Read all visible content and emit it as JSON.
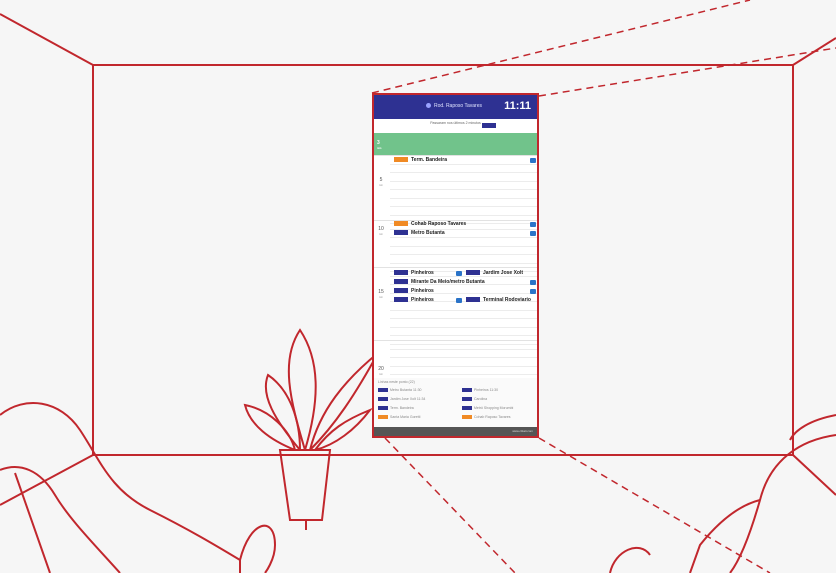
{
  "scene": {
    "line_color": "#c1272d",
    "background": "#f6f6f6"
  },
  "display": {
    "stop_name": "Rod. Raposo Tavares",
    "clock": "11:11",
    "update_note": "Passaram nos últimos 2 minutos",
    "header_color": "#2e3192",
    "green_minutes": "3",
    "sections": [
      {
        "minutes": "5",
        "unit": "min",
        "rows": [
          {
            "route_color": "orange",
            "dest": "Term. Bandeira"
          }
        ]
      },
      {
        "minutes": "10",
        "unit": "min",
        "rows": [
          {
            "route_color": "orange",
            "dest": "Cohab Raposo Tavares"
          },
          {
            "route_color": "blue",
            "dest": "Metro Butanta"
          }
        ]
      },
      {
        "minutes": "15",
        "unit": "min",
        "rows": [
          {
            "route_color": "blue",
            "dest": "Pinheiros",
            "dest2": "Jardim Jose Xolt"
          },
          {
            "route_color": "blue",
            "dest": "Mirante Da Meio/metro Butanta"
          },
          {
            "route_color": "blue",
            "dest": "Pinheiros"
          },
          {
            "route_color": "blue",
            "dest": "Pinheiros",
            "dest2": "Terminal Rodoviario"
          }
        ]
      },
      {
        "minutes": "20",
        "unit": "min",
        "rows": []
      }
    ],
    "footer_title": "Linhas neste ponto (22)",
    "footer_items": [
      {
        "dest": "Metro Butanta",
        "time": "11:30",
        "color": "blue"
      },
      {
        "dest": "Pinheiros",
        "time": "11:30",
        "color": "blue"
      },
      {
        "dest": "Jardim Jose Xolt",
        "time": "11:34",
        "color": "blue"
      },
      {
        "dest": "Carolina",
        "time": "",
        "color": "blue"
      },
      {
        "dest": "Term. Bandeira",
        "time": "",
        "color": "blue"
      },
      {
        "dest": "Metrô Shopping Morumbi",
        "time": "",
        "color": "blue"
      },
      {
        "dest": "Santa Maria Goretti",
        "time": "",
        "color": "orange"
      },
      {
        "dest": "Cohab Raposo Tavares",
        "time": "",
        "color": "orange"
      }
    ],
    "brand": "www.cittati.com"
  }
}
